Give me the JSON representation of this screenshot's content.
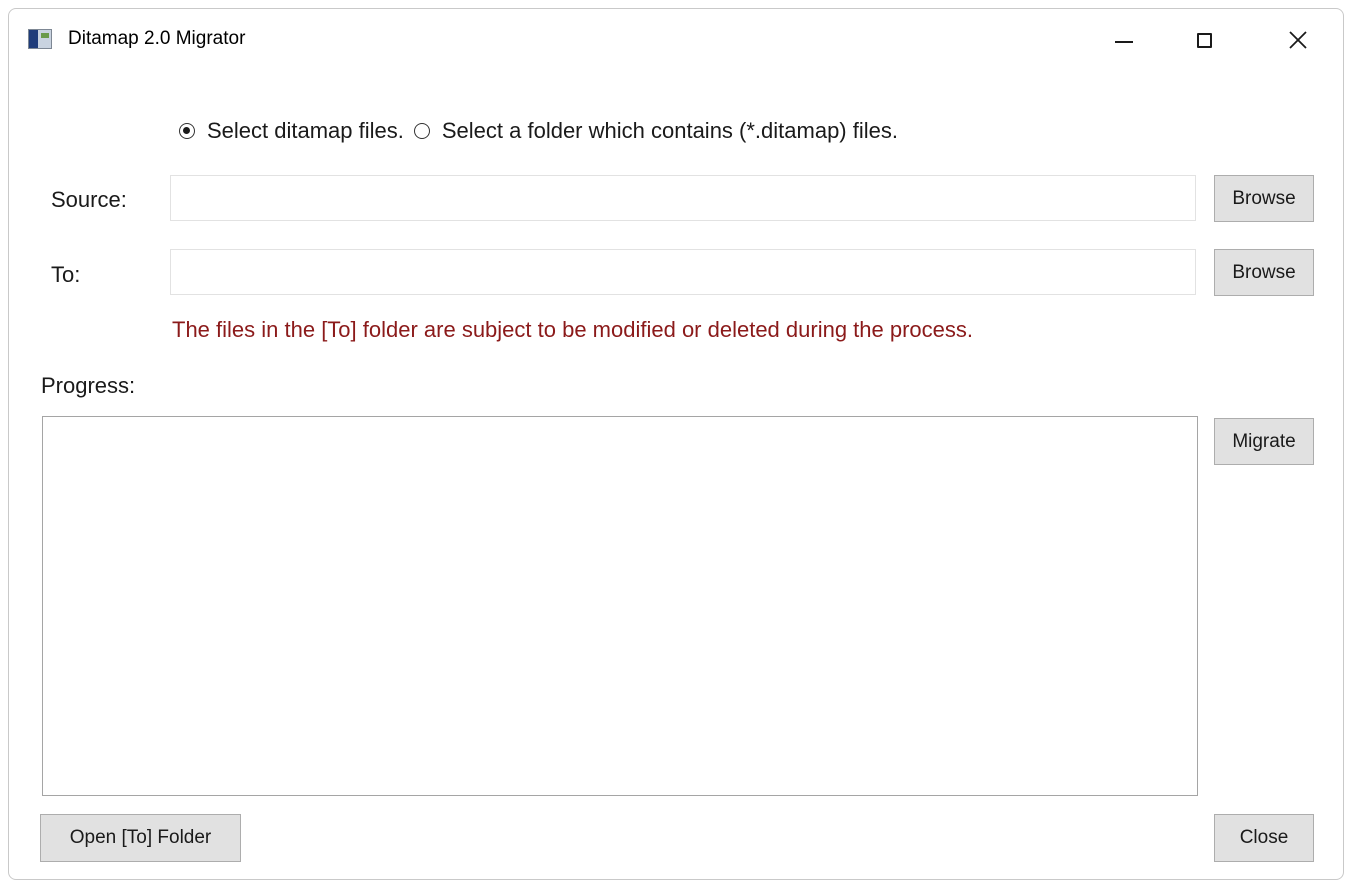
{
  "window": {
    "title": "Ditamap 2.0 Migrator",
    "icon": "app-icon"
  },
  "caption_buttons": {
    "minimize_icon": "minimize-icon",
    "maximize_icon": "maximize-icon",
    "close_icon": "close-icon"
  },
  "mode": {
    "options": [
      {
        "label": "Select ditamap files.",
        "checked": true
      },
      {
        "label": "Select a folder which contains (*.ditamap) files.",
        "checked": false
      }
    ]
  },
  "source": {
    "label": "Source:",
    "value": "",
    "browse_label": "Browse"
  },
  "to": {
    "label": "To:",
    "value": "",
    "browse_label": "Browse"
  },
  "warning_text": "The files in the [To] folder are subject to be modified or deleted during the process.",
  "colors": {
    "warning": "#8b1a1a",
    "button_bg": "#e1e1e1",
    "button_border": "#adadad"
  },
  "progress": {
    "label": "Progress:",
    "value": ""
  },
  "buttons": {
    "migrate": "Migrate",
    "open_to_folder": "Open [To] Folder",
    "close": "Close"
  }
}
